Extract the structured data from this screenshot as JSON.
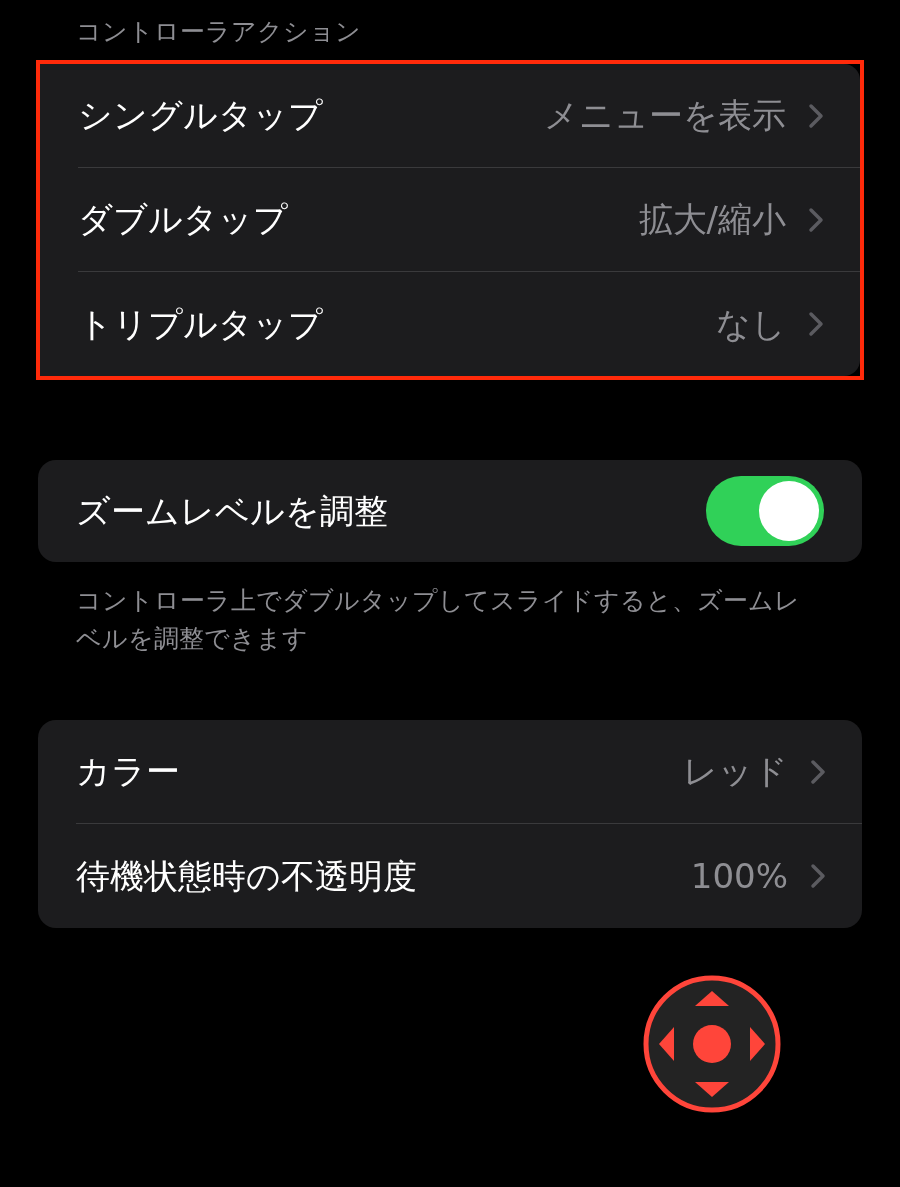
{
  "section_header": "コントローラアクション",
  "action_group": {
    "highlighted": true,
    "rows": [
      {
        "label": "シングルタップ",
        "value": "メニューを表示"
      },
      {
        "label": "ダブルタップ",
        "value": "拡大/縮小"
      },
      {
        "label": "トリプルタップ",
        "value": "なし"
      }
    ]
  },
  "zoom_toggle": {
    "label": "ズームレベルを調整",
    "on": true
  },
  "zoom_footer": "コントローラ上でダブルタップしてスライドすると、ズームレベルを調整できます",
  "appearance_group": {
    "rows": [
      {
        "label": "カラー",
        "value": "レッド"
      },
      {
        "label": "待機状態時の不透明度",
        "value": "100%"
      }
    ]
  }
}
